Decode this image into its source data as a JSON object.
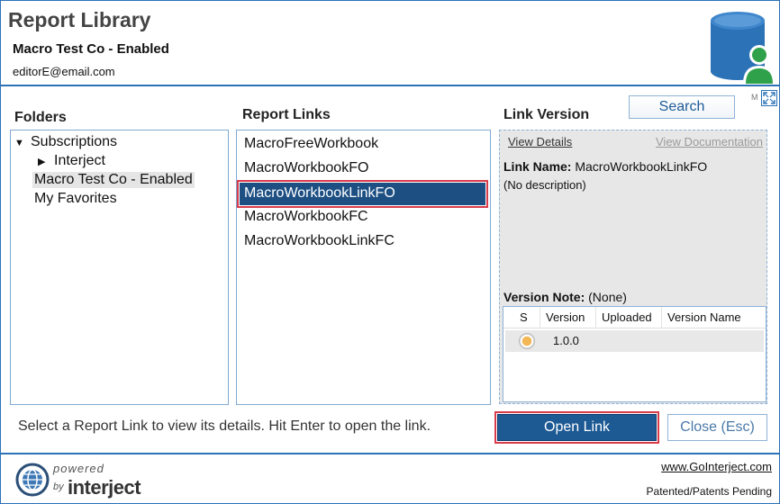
{
  "header": {
    "title": "Report Library",
    "company": "Macro Test Co - Enabled",
    "email": "editorE@email.com"
  },
  "folders": {
    "title": "Folders",
    "items": [
      {
        "label": "Subscriptions",
        "expanded": true
      },
      {
        "label": "Interject",
        "collapsed": true
      },
      {
        "label": "Macro Test Co - Enabled",
        "selected": true
      },
      {
        "label": "My Favorites"
      }
    ]
  },
  "report_links": {
    "title": "Report Links",
    "items": [
      "MacroFreeWorkbook",
      "MacroWorkbookFO",
      "MacroWorkbookLinkFO",
      "MacroWorkbookFC",
      "MacroWorkbookLinkFC"
    ],
    "selected": "MacroWorkbookLinkFO"
  },
  "toolbar": {
    "search_label": "Search",
    "m_label": "M"
  },
  "link_version": {
    "title": "Link Version",
    "view_details": "View Details",
    "view_documentation": "View Documentation",
    "link_name_label": "Link Name:",
    "link_name_value": "MacroWorkbookLinkFO",
    "description": "(No description)",
    "version_note_label": "Version Note:",
    "version_note_value": "(None)",
    "table": {
      "columns": [
        "S",
        "Version",
        "Uploaded",
        "Version Name"
      ],
      "rows": [
        {
          "status": "pending",
          "version": "1.0.0",
          "uploaded": "",
          "version_name": ""
        }
      ]
    }
  },
  "footer": {
    "hint": "Select a Report Link to view its details. Hit Enter to open the link.",
    "open_label": "Open Link",
    "close_label": "Close (Esc)",
    "logo_powered": "powered",
    "logo_by": "by",
    "logo_brand": "interject",
    "website": "www.GoInterject.com",
    "patent": "Patented/Patents Pending"
  },
  "colors": {
    "accent": "#2b72b7",
    "selected_bg": "#1d4f83",
    "highlight_outline": "#d83b4a",
    "status_dot": "#f3b756"
  }
}
